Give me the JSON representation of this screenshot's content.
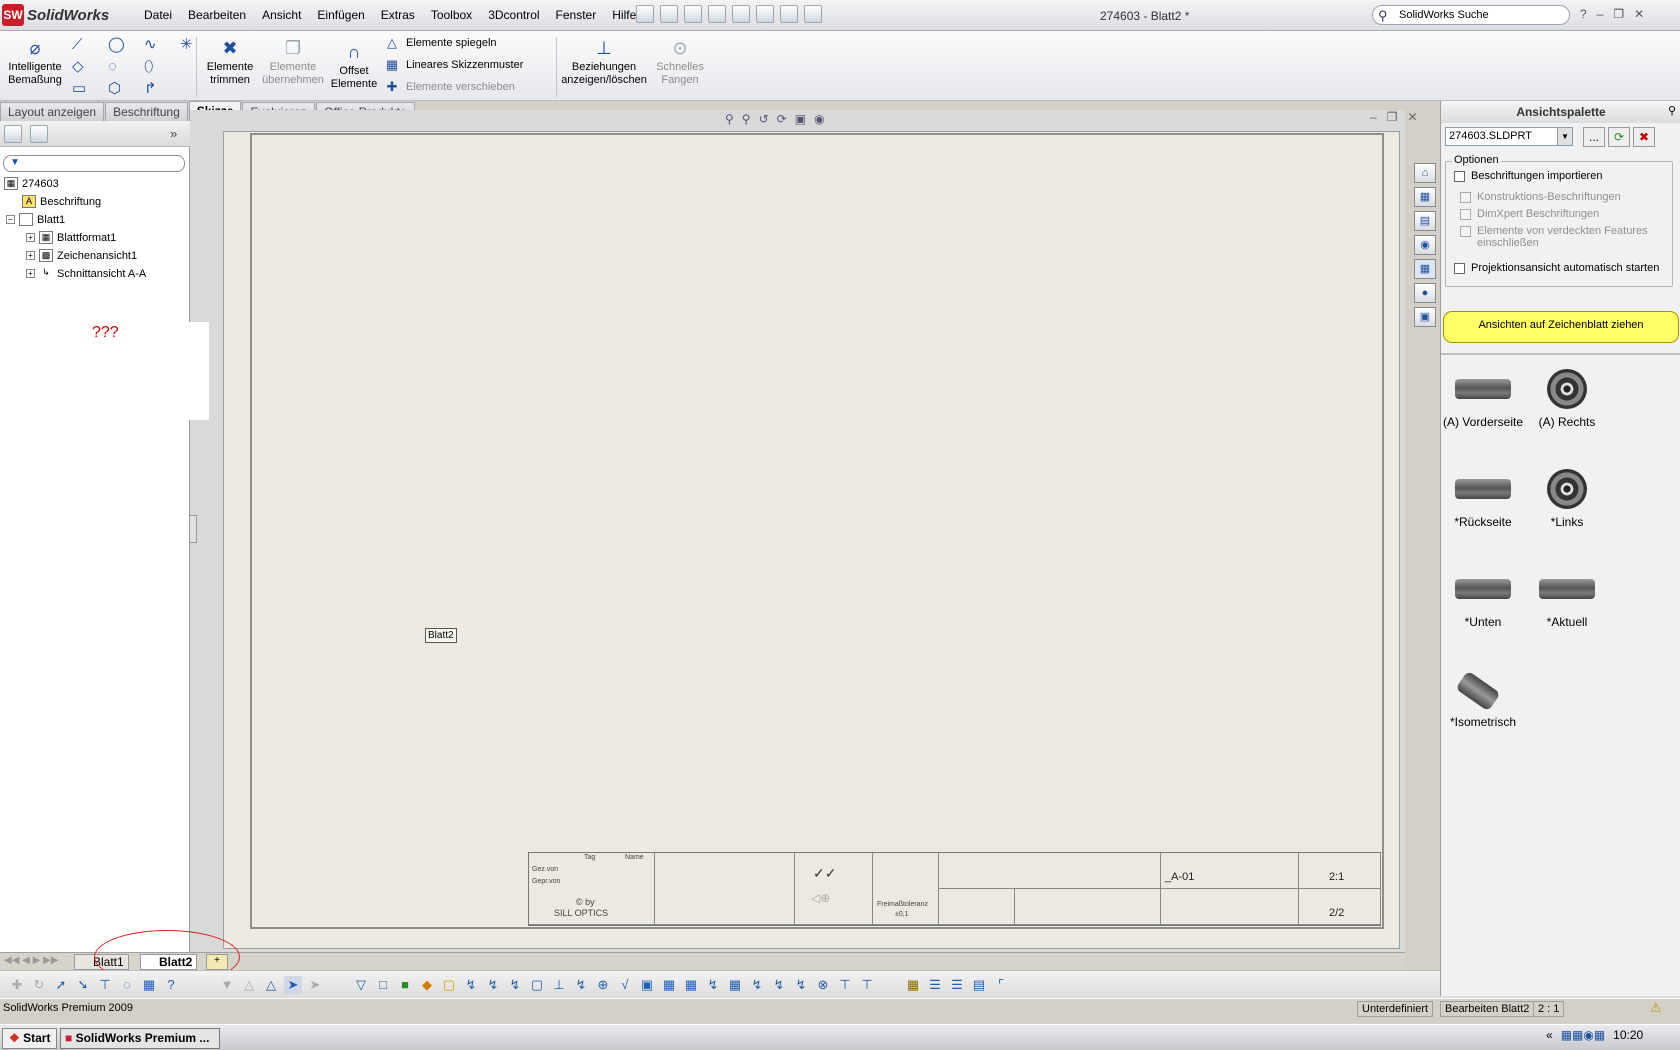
{
  "app": {
    "name": "SolidWorks",
    "doc_title": "274603 - Blatt2 *"
  },
  "menu": [
    "Datei",
    "Bearbeiten",
    "Ansicht",
    "Einfügen",
    "Extras",
    "Toolbox",
    "3Dcontrol",
    "Fenster",
    "Hilfe"
  ],
  "search": {
    "placeholder": "SolidWorks Suche"
  },
  "ribbon": {
    "smart_dim": "Intelligente Bemaßung",
    "trim": "Elemente trimmen",
    "convert": "Elemente übernehmen",
    "offset": "Offset Elemente",
    "mirror": "Elemente spiegeln",
    "linear_pattern": "Lineares Skizzenmuster",
    "move": "Elemente verschieben",
    "relations": "Beziehungen anzeigen/löschen",
    "quick_snap": "Schnelles Fangen"
  },
  "tabs": [
    "Layout anzeigen",
    "Beschriftung",
    "Skizze",
    "Evaluieren",
    "Office Produkte"
  ],
  "active_tab": "Skizze",
  "tree": {
    "root": "274603",
    "items": [
      "Beschriftung",
      "Blatt1",
      "Blattformat1",
      "Zeichenansicht1",
      "Schnittansicht A-A"
    ]
  },
  "annotation": {
    "question": "???"
  },
  "sheet": {
    "label": "Blatt2",
    "title_block": {
      "col_tag": "Tag",
      "col_name": "Name",
      "drawn_by": "Gez.von",
      "checked_by": "Gepr.von",
      "copyright": "© by",
      "company": "SILL OPTICS",
      "tolerance_label": "Freimaßtoleranz",
      "tolerance_value": "±0,1",
      "drawing_no": "_A-01",
      "scale": "2:1",
      "sheet_no": "2/2"
    }
  },
  "sheet_tabs": [
    "Blatt1",
    "Blatt2"
  ],
  "active_sheet": "Blatt2",
  "status": {
    "product": "SolidWorks Premium 2009",
    "state": "Unterdefiniert",
    "editing": "Bearbeiten Blatt2",
    "scale": "2 : 1"
  },
  "taskbar": {
    "start": "Start",
    "task": "SolidWorks Premium ...",
    "time": "10:20"
  },
  "palette": {
    "title": "Ansichtspalette",
    "file": "274603.SLDPRT",
    "options_label": "Optionen",
    "options": [
      {
        "label": "Beschriftungen importieren",
        "checked": false,
        "enabled": true
      },
      {
        "label": "Konstruktions-Beschriftungen",
        "checked": false,
        "enabled": false
      },
      {
        "label": "DimXpert Beschriftungen",
        "checked": false,
        "enabled": false
      },
      {
        "label": "Elemente von verdeckten Features einschließen",
        "checked": false,
        "enabled": false
      },
      {
        "label": "Projektionsansicht automatisch starten",
        "checked": false,
        "enabled": true
      }
    ],
    "drag_hint": "Ansichten auf Zeichenblatt ziehen",
    "views": [
      "(A) Vorderseite",
      "(A) Rechts",
      "*Rückseite",
      "*Links",
      "*Unten",
      "*Aktuell",
      "*Isometrisch"
    ]
  },
  "colors": {
    "accent": "#1f4fa0",
    "highlight": "#ffff66",
    "annotation_red": "#d40000"
  }
}
